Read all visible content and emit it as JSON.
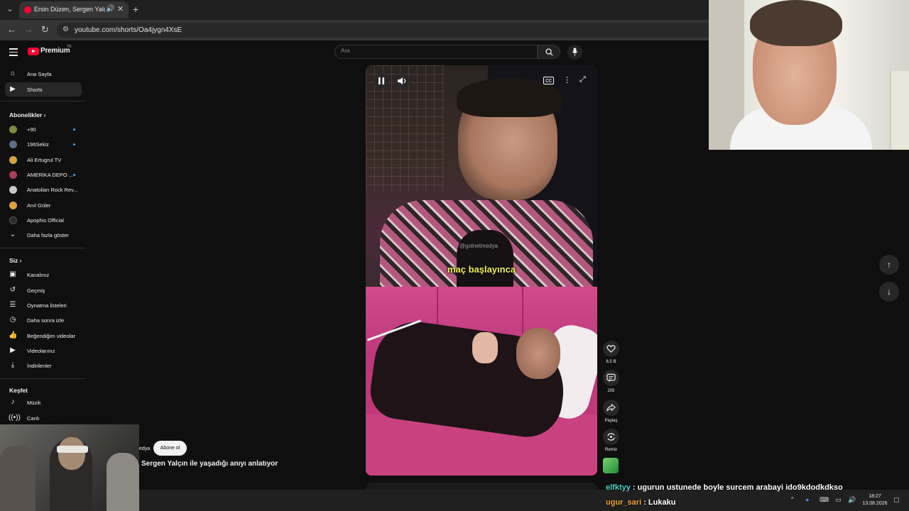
{
  "browser": {
    "tab_title": "Ersin Düzen, Sergen Yalçın i",
    "url": "youtube.com/shorts/Oa4jygn4XsE"
  },
  "header": {
    "brand": "Premium",
    "region": "TR",
    "search_placeholder": "Ara"
  },
  "sidebar": {
    "main": [
      {
        "label": "Ana Sayfa",
        "icon": "home-icon"
      },
      {
        "label": "Shorts",
        "icon": "shorts-icon",
        "active": true
      }
    ],
    "subscriptions_heading": "Abonelikler",
    "subscriptions": [
      {
        "label": "+90",
        "color": "#7a8b3a",
        "dot": true
      },
      {
        "label": "196Sekiz",
        "color": "#5b6f8a",
        "dot": true
      },
      {
        "label": "Ali Ertugrul TV",
        "color": "#d9a23a",
        "dot": false
      },
      {
        "label": "AMERİKA DEPO ...",
        "color": "#b03a5a",
        "dot": true
      },
      {
        "label": "Anatolian Rock Rev...",
        "color": "#c8c8c8",
        "dot": false
      },
      {
        "label": "Anıl Güler",
        "color": "#e0a040",
        "dot": false
      },
      {
        "label": "Apophis Official",
        "color": "#2a2a2a",
        "dot": false
      }
    ],
    "show_more": "Daha fazla göster",
    "you_heading": "Siz",
    "you": [
      {
        "label": "Kanalınız",
        "icon": "channel-icon"
      },
      {
        "label": "Geçmiş",
        "icon": "history-icon"
      },
      {
        "label": "Oynatma listeleri",
        "icon": "playlist-icon"
      },
      {
        "label": "Daha sonra izle",
        "icon": "watch-later-icon"
      },
      {
        "label": "Beğendiğim videolar",
        "icon": "like-icon"
      },
      {
        "label": "Videolarınız",
        "icon": "your-videos-icon"
      },
      {
        "label": "İndirilenler",
        "icon": "download-icon"
      }
    ],
    "explore_heading": "Keşfet",
    "explore": [
      {
        "label": "Müzik",
        "icon": "music-icon"
      },
      {
        "label": "Canlı",
        "icon": "live-icon"
      }
    ]
  },
  "short": {
    "watermark": "@golnetmedya",
    "caption": "maç başlayınca",
    "channel_fragment": "edya",
    "subscribe_label": "Abone ol",
    "title": "Sergen Yalçın ile yaşadığı anıyı anlatıyor",
    "actions": [
      {
        "label": "6,5 B",
        "icon": "like-icon"
      },
      {
        "label": "205",
        "icon": "comment-icon"
      },
      {
        "label": "Paylaş",
        "icon": "share-icon"
      },
      {
        "label": "Remix",
        "icon": "remix-icon"
      }
    ]
  },
  "chat": [
    {
      "user": "elfktyy",
      "message": ": ugurun ustunede boyle surcem arabayi ido9kdodkdkso"
    },
    {
      "user": "ugur_sari",
      "message": ": Lukaku"
    }
  ],
  "taskbar": {
    "time": "18:27",
    "date": "13.08.2026"
  }
}
